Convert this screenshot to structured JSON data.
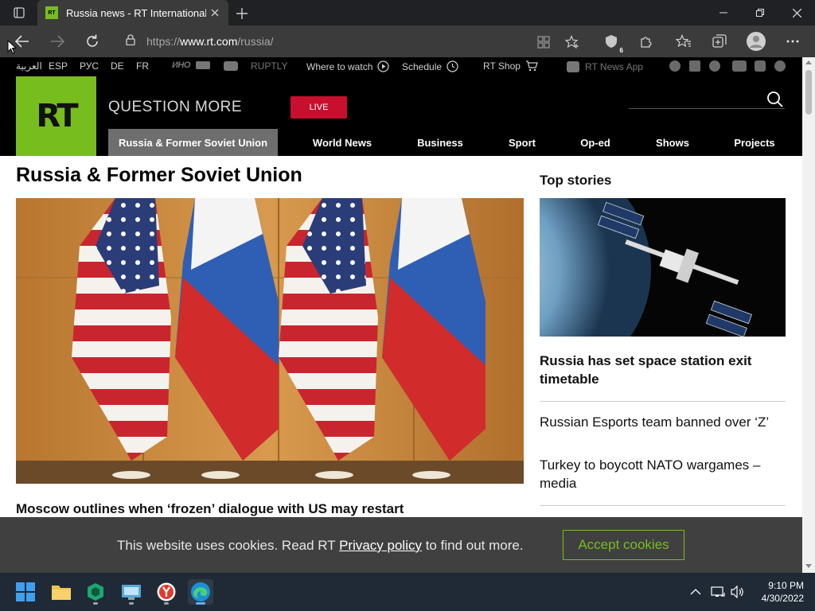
{
  "browser": {
    "tab_title": "Russia news - RT International",
    "tab_favicon_text": "RT",
    "url_scheme": "https://",
    "url_host": "www.rt.com",
    "url_path": "/russia/",
    "extension_badge": "6"
  },
  "site": {
    "langbar": {
      "languages": [
        "العربية",
        "ESP",
        "РУС",
        "DE",
        "FR"
      ],
      "inotv": "ИНО",
      "ruptly": "RUPTLY",
      "where_to_watch": "Where to watch",
      "schedule": "Schedule",
      "shop": "RT Shop",
      "app": "RT News App"
    },
    "logo_text": "RT",
    "tagline": "QUESTION MORE",
    "live_label": "LIVE",
    "nav": [
      "Russia & Former Soviet Union",
      "World News",
      "Business",
      "Sport",
      "Op-ed",
      "Shows",
      "Projects"
    ]
  },
  "main": {
    "section_title": "Russia & Former Soviet Union",
    "hero_headline": "Moscow outlines when ‘frozen’ dialogue with US may restart"
  },
  "sidebar": {
    "title": "Top stories",
    "top_headline": "Russia has set space station exit timetable",
    "stories": [
      "Russian Esports team banned over ‘Z’",
      "Turkey to boycott NATO wargames – media"
    ]
  },
  "cookie": {
    "text_before": "This website uses cookies. Read RT ",
    "link": "Privacy policy",
    "text_after": " to find out more.",
    "accept": "Accept cookies"
  },
  "taskbar": {
    "time": "9:10 PM",
    "date": "4/30/2022"
  },
  "colors": {
    "brand_green": "#77bd1e",
    "live_red": "#c8102e",
    "nav_active": "#6e6e6e"
  }
}
